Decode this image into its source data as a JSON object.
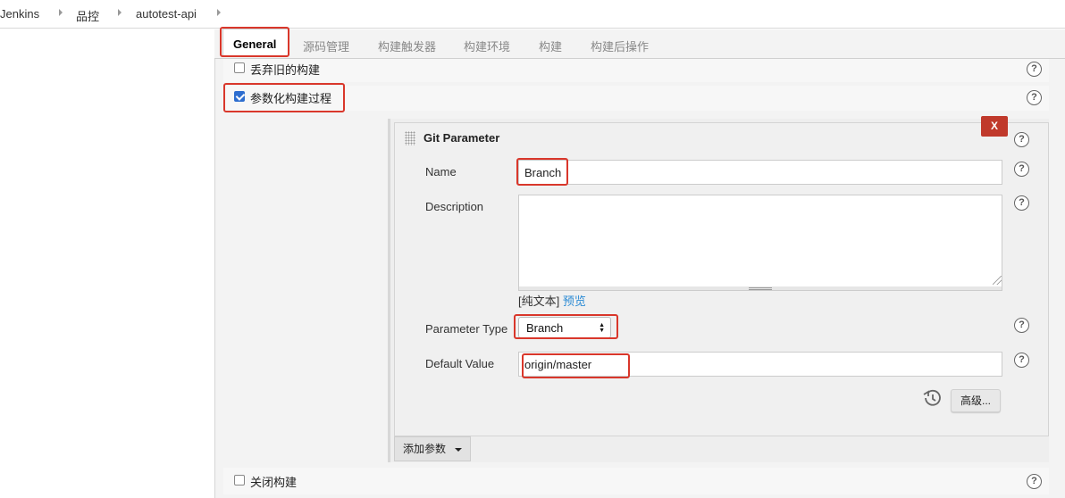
{
  "breadcrumb": {
    "items": [
      "Jenkins",
      "品控",
      "autotest-api"
    ]
  },
  "tabs": [
    "General",
    "源码管理",
    "构建触发器",
    "构建环境",
    "构建",
    "构建后操作"
  ],
  "options": {
    "discard_old_builds": {
      "label": "丢弃旧的构建",
      "checked": false
    },
    "parameterized": {
      "label": "参数化构建过程",
      "checked": true
    },
    "disable_build": {
      "label": "关闭构建",
      "checked": false
    }
  },
  "param": {
    "title": "Git Parameter",
    "delete_label": "X",
    "name_label": "Name",
    "name_value": "Branch",
    "description_label": "Description",
    "description_value": "",
    "mode_plain": "[纯文本]",
    "mode_preview": "预览",
    "type_label": "Parameter Type",
    "type_value": "Branch",
    "default_label": "Default Value",
    "default_value": "origin/master",
    "advanced_label": "高级..."
  },
  "add_param_label": "添加参数",
  "help_glyph": "?",
  "colors": {
    "accent_red": "#d9372b",
    "checkbox_blue": "#2e6ecf",
    "link_blue": "#2a8ad4",
    "delete_red": "#c0392b"
  },
  "icons": [
    "breadcrumb-chevron-icon",
    "help-icon",
    "drag-grip-icon",
    "history-icon",
    "dropdown-caret-icon",
    "select-arrows-icon"
  ]
}
